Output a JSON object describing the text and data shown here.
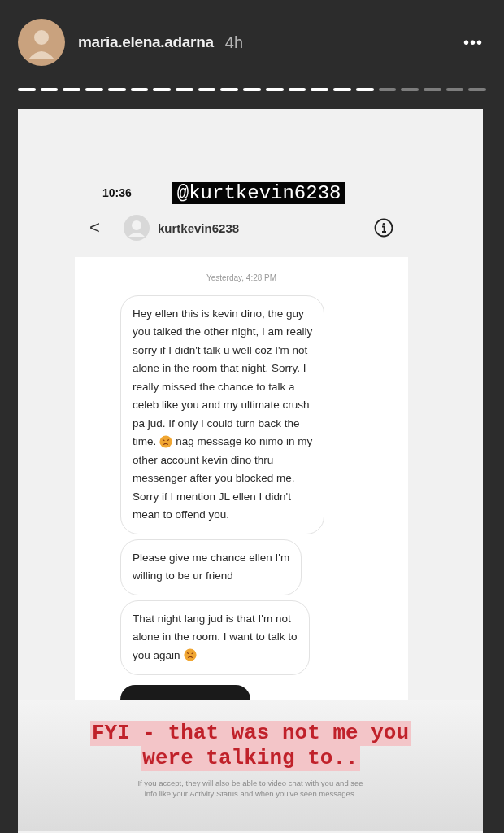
{
  "story_header": {
    "username": "maria.elena.adarna",
    "age": "4h",
    "more": "•••"
  },
  "story_progress": [
    {
      "seen": true
    },
    {
      "seen": true
    },
    {
      "seen": true
    },
    {
      "seen": true
    },
    {
      "seen": true
    },
    {
      "seen": true
    },
    {
      "seen": true
    },
    {
      "seen": true
    },
    {
      "seen": true
    },
    {
      "seen": true
    },
    {
      "seen": true
    },
    {
      "seen": true
    },
    {
      "seen": true
    },
    {
      "seen": true
    },
    {
      "seen": true
    },
    {
      "seen": true
    },
    {
      "seen": false
    },
    {
      "seen": false
    },
    {
      "seen": false
    },
    {
      "seen": false
    },
    {
      "seen": false
    }
  ],
  "screenshot": {
    "status_time": "10:36",
    "tag_label": "@kurtkevin6238",
    "chat_header": {
      "back": "<",
      "username": "kurtkevin6238"
    },
    "timestamp": "Yesterday, 4:28 PM",
    "messages": [
      {
        "lines": [
          [
            {
              "kind": "text",
              "text": "Hey ellen this is kevin dino, the guy"
            }
          ],
          [
            {
              "kind": "text",
              "text": "you talked the other night, I am really"
            }
          ],
          [
            {
              "kind": "text",
              "text": "sorry if I didn't talk u well coz I'm not"
            }
          ],
          [
            {
              "kind": "text",
              "text": "alone in the room that night. Sorry. I"
            }
          ],
          [
            {
              "kind": "text",
              "text": "really missed the chance to talk a"
            }
          ],
          [
            {
              "kind": "text",
              "text": "celeb like you and my ultimate crush"
            }
          ],
          [
            {
              "kind": "text",
              "text": "pa jud. If only I could turn back the"
            }
          ],
          [
            {
              "kind": "text",
              "text": "time."
            },
            {
              "kind": "emoji"
            },
            {
              "kind": "text",
              "text": "nag message ko nimo in my"
            }
          ],
          [
            {
              "kind": "text",
              "text": "other account kevin dino thru"
            }
          ],
          [
            {
              "kind": "text",
              "text": "messenger after you blocked me."
            }
          ],
          [
            {
              "kind": "text",
              "text": "Sorry if I mention JL ellen I didn't"
            }
          ],
          [
            {
              "kind": "text",
              "text": "mean to offend you."
            }
          ]
        ]
      },
      {
        "lines": [
          [
            {
              "kind": "text",
              "text": "Please give me chance ellen I'm"
            }
          ],
          [
            {
              "kind": "text",
              "text": "willing to be ur friend"
            }
          ]
        ]
      },
      {
        "lines": [
          [
            {
              "kind": "text",
              "text": "That night lang jud is that I'm not"
            }
          ],
          [
            {
              "kind": "text",
              "text": "alone in the room. I want to talk to"
            }
          ],
          [
            {
              "kind": "text",
              "text": "you again"
            },
            {
              "kind": "emoji"
            }
          ]
        ]
      }
    ],
    "caption": [
      "FYI - that was not me you",
      "were talking to.."
    ],
    "notice": "If you accept, they will also be able to video chat with you and see info like your Activity Status and when you've seen messages."
  }
}
